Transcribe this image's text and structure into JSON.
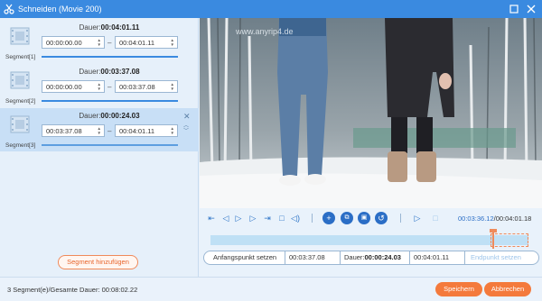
{
  "window": {
    "title": "Schneiden (Movie 200)"
  },
  "segments": [
    {
      "label": "Segment[1]",
      "duration_label": "Dauer:",
      "duration": "00:04:01.11",
      "start": "00:00:00.00",
      "end": "00:04:01.11"
    },
    {
      "label": "Segment[2]",
      "duration_label": "Dauer:",
      "duration": "00:03:37.08",
      "start": "00:00:00.00",
      "end": "00:03:37.08"
    },
    {
      "label": "Segment[3]",
      "duration_label": "Dauer:",
      "duration": "00:00:24.03",
      "start": "00:03:37.08",
      "end": "00:04:01.11"
    }
  ],
  "add_segment_label": "Segment hinzufügen",
  "video": {
    "watermark": "www.anyrip4.de"
  },
  "player": {
    "current_time": "00:03:36.12",
    "total_time": "/00:04:01.18",
    "timeline_progress": 0.885
  },
  "set_row": {
    "set_start_label": "Anfangspunkt setzen",
    "start": "00:03:37.08",
    "duration_label": "Dauer:",
    "duration": "00:00:24.03",
    "end": "00:04:01.11",
    "set_end_label": "Endpunkt setzen"
  },
  "footer": {
    "status": "3 Segment(e)/Gesamte Dauer: 00:08:02.22",
    "save_label": "Speichern",
    "cancel_label": "Abbrechen"
  },
  "colors": {
    "titlebar": "#3a8ae0",
    "accent": "#2b6ec6",
    "orange": "#f47a3c"
  }
}
